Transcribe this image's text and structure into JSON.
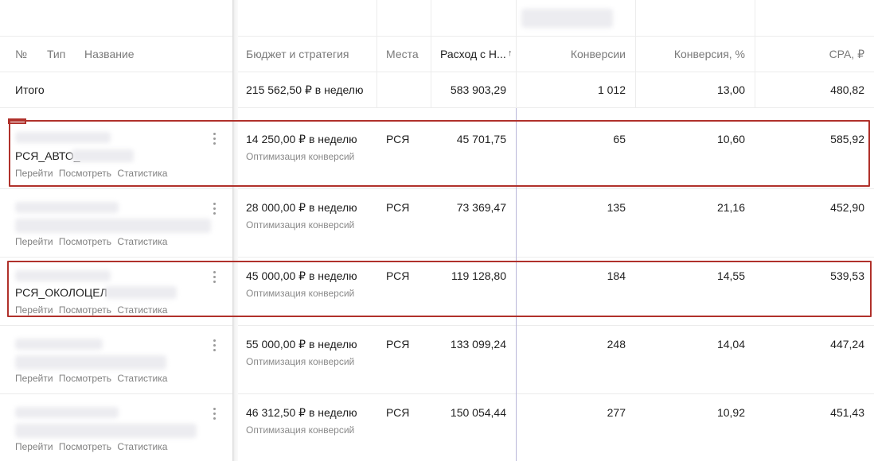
{
  "header": {
    "col_no": "№",
    "col_type": "Тип",
    "col_name": "Название",
    "col_budget": "Бюджет и стратегия",
    "col_places": "Места",
    "col_spend": "Расход с Н...",
    "col_spend_sort": "↑",
    "col_conversions": "Конверсии",
    "col_conversion_pct": "Конверсия, %",
    "col_cpa": "CPA, ₽"
  },
  "total": {
    "label": "Итого",
    "budget": "215 562,50 ₽ в неделю",
    "spend": "583 903,29",
    "conversions": "1 012",
    "conversion_pct": "13,00",
    "cpa": "480,82"
  },
  "row_links": {
    "go": "Перейти",
    "view": "Посмотреть",
    "stats": "Статистика"
  },
  "rows": [
    {
      "name": "РСЯ_АВТО_",
      "budget": "14 250,00 ₽ в неделю",
      "strategy": "Оптимизация конверсий",
      "places": "РСЯ",
      "spend": "45 701,75",
      "conversions": "65",
      "conversion_pct": "10,60",
      "cpa": "585,92"
    },
    {
      "name": "",
      "budget": "28 000,00 ₽ в неделю",
      "strategy": "Оптимизация конверсий",
      "places": "РСЯ",
      "spend": "73 369,47",
      "conversions": "135",
      "conversion_pct": "21,16",
      "cpa": "452,90"
    },
    {
      "name": "РСЯ_ОКОЛОЦЕЛ",
      "budget": "45 000,00 ₽ в неделю",
      "strategy": "Оптимизация конверсий",
      "places": "РСЯ",
      "spend": "119 128,80",
      "conversions": "184",
      "conversion_pct": "14,55",
      "cpa": "539,53"
    },
    {
      "name": "",
      "budget": "55 000,00 ₽ в неделю",
      "strategy": "Оптимизация конверсий",
      "places": "РСЯ",
      "spend": "133 099,24",
      "conversions": "248",
      "conversion_pct": "14,04",
      "cpa": "447,24"
    },
    {
      "name": "",
      "budget": "46 312,50 ₽ в неделю",
      "strategy": "Оптимизация конверсий",
      "places": "РСЯ",
      "spend": "150 054,44",
      "conversions": "277",
      "conversion_pct": "10,92",
      "cpa": "451,43"
    }
  ],
  "colors": {
    "highlight": "#b0312b",
    "divider": "#ececec",
    "muted_text": "#7a7a7a"
  },
  "icons": {
    "row_menu": "kebab-menu-icon"
  }
}
